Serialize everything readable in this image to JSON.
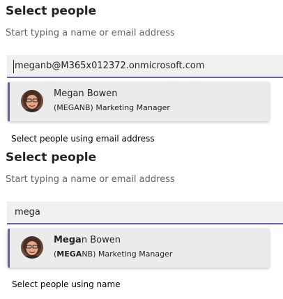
{
  "panels": [
    {
      "title": "Select people",
      "hint": "Start typing a name or email address",
      "input_value": "meganb@M365x012372.onmicrosoft.com",
      "suggestion": {
        "name": "Megan Bowen",
        "detail": "(MEGANB) Marketing Manager"
      },
      "caption": "Select people using email address"
    },
    {
      "title": "Select people",
      "hint": "Start typing a name or email address",
      "input_value": "mega",
      "suggestion": {
        "name_match": "Mega",
        "name_rest": "n Bowen",
        "detail_open": "(",
        "detail_match": "MEGA",
        "detail_rest": "NB) Marketing Manager"
      },
      "caption": "Select people using name"
    }
  ],
  "colors": {
    "accent": "#6264a7",
    "input_bg": "#f0f0f0",
    "suggestion_bg": "#ebebeb"
  },
  "icons": {
    "avatar": "person-photo-avatar"
  }
}
